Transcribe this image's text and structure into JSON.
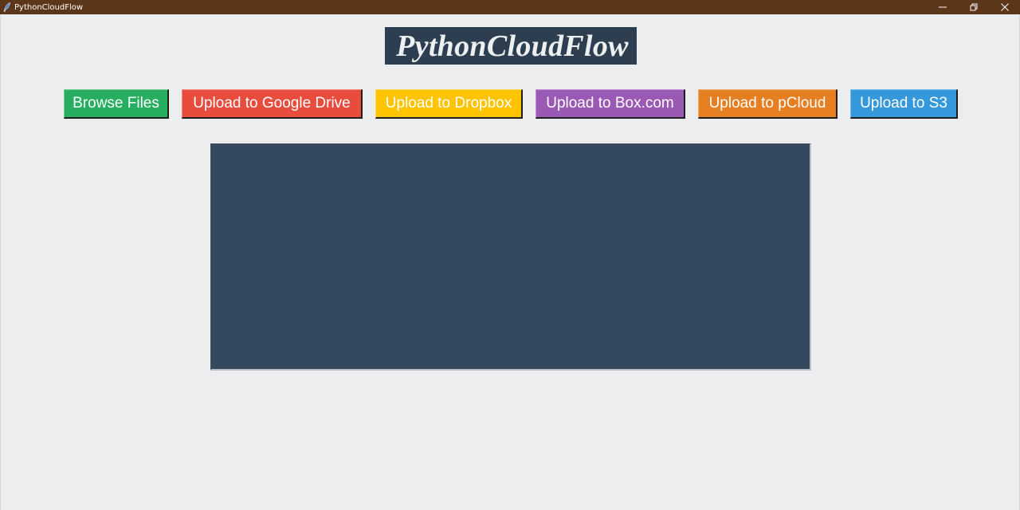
{
  "window": {
    "title": "PythonCloudFlow",
    "app_icon": "feather-icon",
    "controls": [
      {
        "name": "minimize",
        "icon": "minimize-icon"
      },
      {
        "name": "restore",
        "icon": "restore-icon"
      },
      {
        "name": "close",
        "icon": "close-icon"
      }
    ]
  },
  "header": {
    "logo_text": "PythonCloudFlow"
  },
  "toolbar": {
    "buttons": [
      {
        "label": "Browse Files",
        "color": "#27ae60"
      },
      {
        "label": "Upload to Google Drive",
        "color": "#e74c3c"
      },
      {
        "label": "Upload to Dropbox",
        "color": "#ffc300"
      },
      {
        "label": "Upload to Box.com",
        "color": "#9b59b6"
      },
      {
        "label": "Upload to pCloud",
        "color": "#e67e22"
      },
      {
        "label": "Upload to S3",
        "color": "#3498db"
      }
    ]
  },
  "main": {
    "panel_color": "#34495e",
    "panel_content": ""
  }
}
